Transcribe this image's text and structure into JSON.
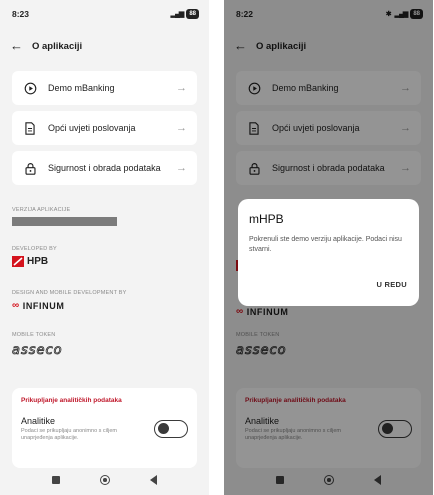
{
  "screen_left": {
    "status": {
      "time": "8:23",
      "signal": "ᵀᴵₗ",
      "battery": "88"
    },
    "header": {
      "title": "O aplikaciji"
    },
    "menu": [
      {
        "label": "Demo mBanking",
        "icon": "play-circle-icon"
      },
      {
        "label": "Opći uvjeti poslovanja",
        "icon": "document-icon"
      },
      {
        "label": "Sigurnost i obrada podataka",
        "icon": "lock-icon"
      }
    ],
    "version_label": "VERZIJA APLIKACIJE",
    "developed_by_label": "DEVELOPED BY",
    "hpb_text": "HPB",
    "design_label": "DESIGN AND MOBILE DEVELOPMENT BY",
    "infinum_text": "INFINUM",
    "mobile_token_label": "MOBILE TOKEN",
    "asseco_text": "asseco",
    "analytics": {
      "section_title": "Prikupljanje analitičkih podataka",
      "item_title": "Analitike",
      "item_sub": "Podaci se prikupljaju anonimno s ciljem unaprjeđenja aplikacije.",
      "enabled": false
    }
  },
  "screen_right": {
    "status": {
      "time": "8:22",
      "battery": "88"
    },
    "header": {
      "title": "O aplikaciji"
    },
    "menu": [
      {
        "label": "Demo mBanking"
      },
      {
        "label": "Opći uvjeti poslovanja"
      },
      {
        "label": "Sigurnost i obrada podataka"
      }
    ],
    "infinum_text": "INFINUM",
    "mobile_token_label": "MOBILE TOKEN",
    "asseco_text": "asseco",
    "analytics": {
      "section_title": "Prikupljanje analitičkih podataka",
      "item_title": "Analitike",
      "item_sub": "Podaci se prikupljaju anonimno s ciljem unaprjeđenja aplikacije."
    },
    "dialog": {
      "title": "mHPB",
      "message": "Pokrenuli ste demo verziju aplikacije. Podaci nisu stvarni.",
      "button": "U REDU"
    }
  },
  "colors": {
    "accent_red": "#c0172a",
    "hpb_red": "#d4131d",
    "background": "#f3f3f3"
  }
}
